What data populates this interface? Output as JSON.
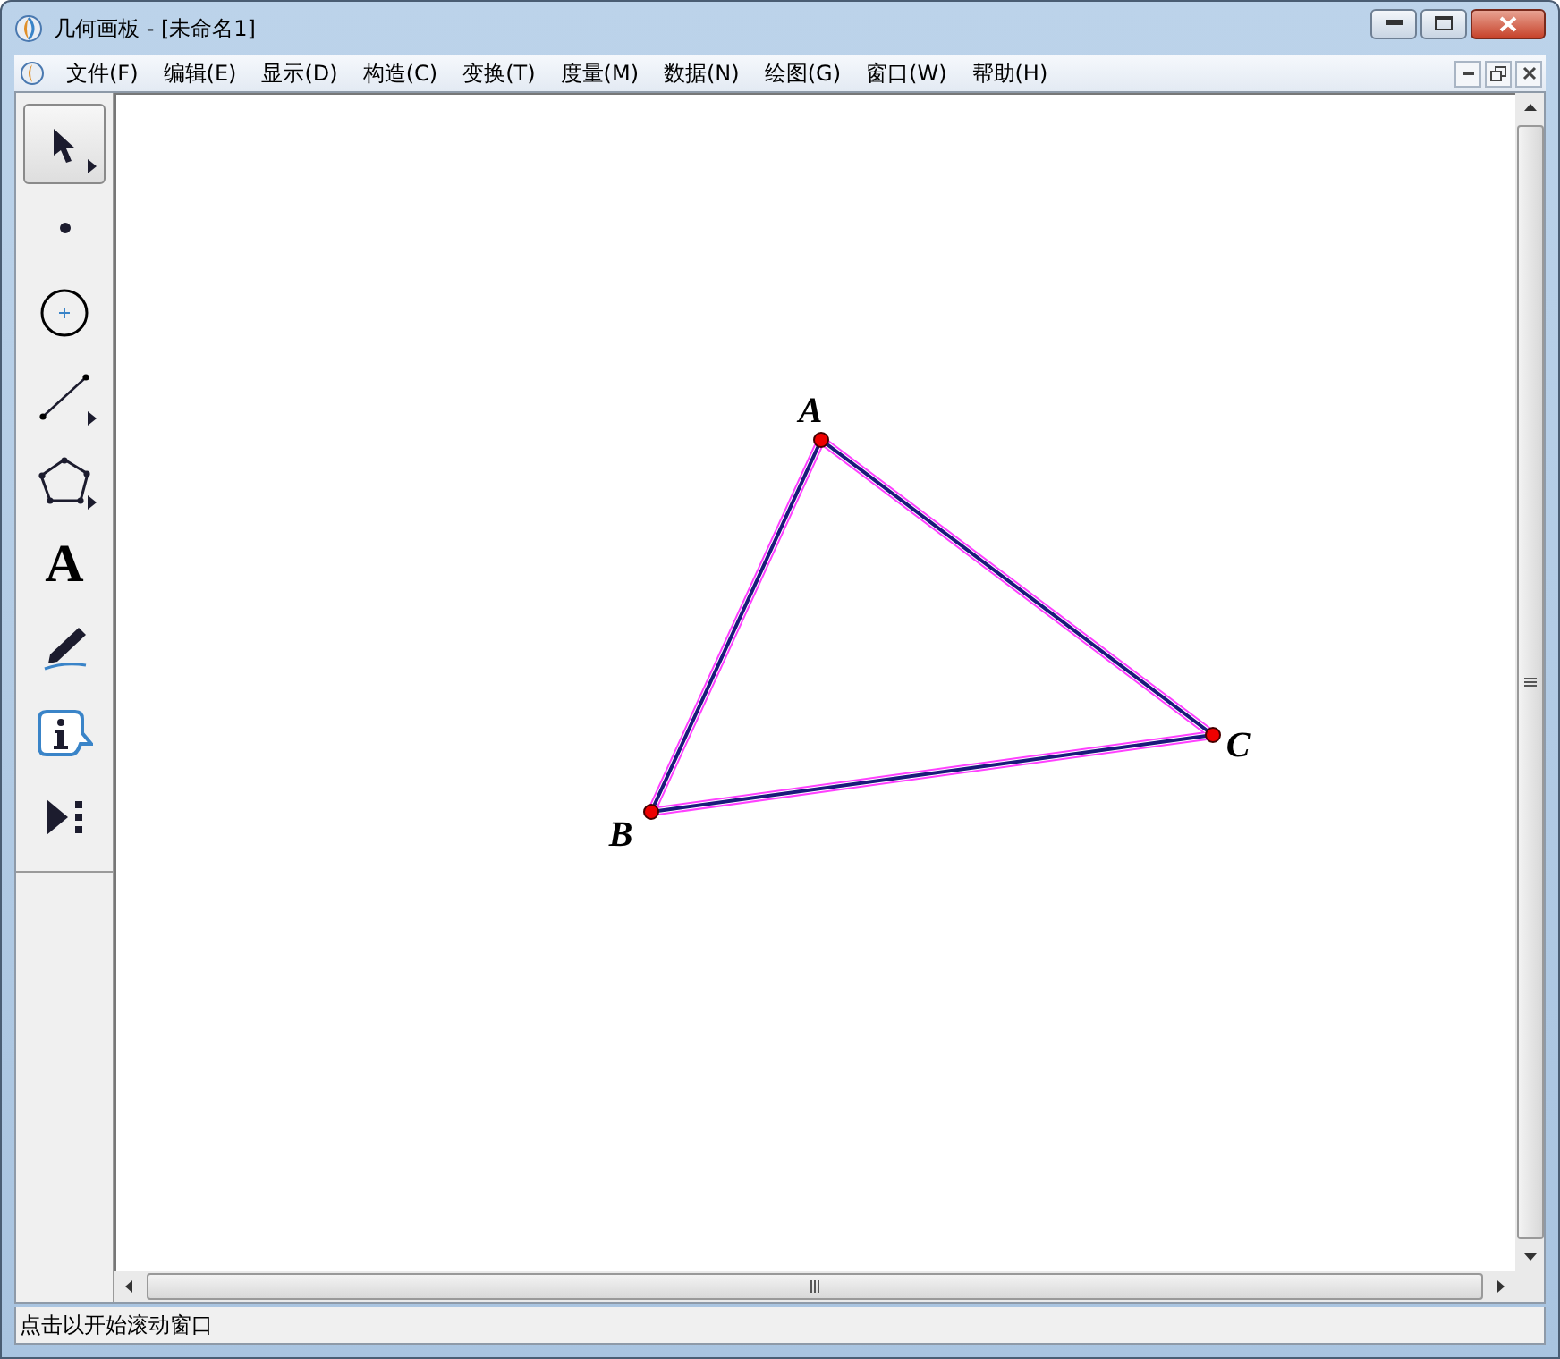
{
  "window": {
    "title": "几何画板 - [未命名1]"
  },
  "menu": [
    "文件(F)",
    "编辑(E)",
    "显示(D)",
    "构造(C)",
    "变换(T)",
    "度量(M)",
    "数据(N)",
    "绘图(G)",
    "窗口(W)",
    "帮助(H)"
  ],
  "toolbar": [
    {
      "kind": "arrow",
      "selected": true,
      "submenu": true
    },
    {
      "kind": "point",
      "selected": false,
      "submenu": false
    },
    {
      "kind": "compass",
      "selected": false,
      "submenu": false
    },
    {
      "kind": "line",
      "selected": false,
      "submenu": true
    },
    {
      "kind": "polygon",
      "selected": false,
      "submenu": true
    },
    {
      "kind": "text",
      "selected": false,
      "submenu": false,
      "glyph": "A"
    },
    {
      "kind": "marker",
      "selected": false,
      "submenu": false
    },
    {
      "kind": "info",
      "selected": false,
      "submenu": false
    },
    {
      "kind": "custom",
      "selected": false,
      "submenu": false
    }
  ],
  "triangle": {
    "selected": true,
    "vertices": [
      {
        "label": "A"
      },
      {
        "label": "B"
      },
      {
        "label": "C"
      }
    ]
  },
  "status_bar": "点击以开始滚动窗口"
}
